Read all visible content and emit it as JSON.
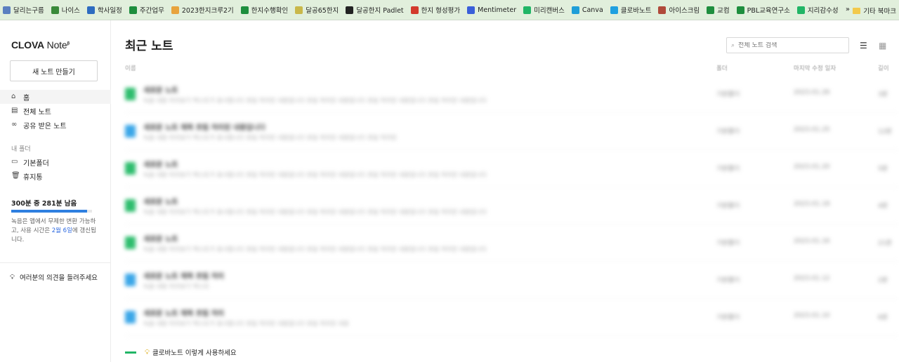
{
  "bookmarks": {
    "items": [
      {
        "label": "달리는구름",
        "color": "#5a7fc0"
      },
      {
        "label": "나이스",
        "color": "#3a8a3a"
      },
      {
        "label": "학사일정",
        "color": "#2d6cc0"
      },
      {
        "label": "주간업무",
        "color": "#1e8e3e"
      },
      {
        "label": "2023한지크루2기",
        "color": "#e8a33d"
      },
      {
        "label": "한지수행확인",
        "color": "#1e8e3e"
      },
      {
        "label": "달공65한지",
        "color": "#c9b84a"
      },
      {
        "label": "달공한지 Padlet",
        "color": "#222222"
      },
      {
        "label": "한지 형성평가",
        "color": "#d33a2c"
      },
      {
        "label": "Mentimeter",
        "color": "#3a5fd9"
      },
      {
        "label": "미리캔버스",
        "color": "#21b566"
      },
      {
        "label": "Canva",
        "color": "#1f9ed8"
      },
      {
        "label": "클로바노트",
        "color": "#1fa0e0"
      },
      {
        "label": "아이스크림",
        "color": "#b04a3a"
      },
      {
        "label": "교컴",
        "color": "#1e8e3e"
      },
      {
        "label": "PBL교육연구소",
        "color": "#1e8e3e"
      },
      {
        "label": "지리감수성",
        "color": "#21b566"
      }
    ],
    "more": "»",
    "other_label": "기타 북마크"
  },
  "sidebar": {
    "logo_main": "CLOVA",
    "logo_note": " Note",
    "logo_mark": "β",
    "new_note": "새 노트 만들기",
    "nav": [
      {
        "label": "홈",
        "icon": "home-icon"
      },
      {
        "label": "전체 노트",
        "icon": "document-icon"
      },
      {
        "label": "공유 받은 노트",
        "icon": "link-icon"
      }
    ],
    "folders_title": "내 폴더",
    "folders": [
      {
        "label": "기본폴더",
        "icon": "folder-icon"
      },
      {
        "label": "휴지통",
        "icon": "trash-icon"
      }
    ],
    "usage": {
      "title": "300분 중 281분 남음",
      "remaining_fraction": 0.937,
      "desc_1": "녹음은 앱에서 무제한 변환 가능하고, 사용 시간은 ",
      "desc_hl": "2월 6일",
      "desc_2": "에 갱신됩니다."
    },
    "feedback": "여러분의 의견을 들려주세요"
  },
  "main": {
    "title": "최근 노트",
    "search_placeholder": "전체 노트 검색",
    "columns": {
      "name": "이름",
      "folder": "폴더",
      "modified": "마지막 수정 일자",
      "length": "길이"
    },
    "rows": [
      {
        "badge_color": "#2ebd6e",
        "title": "새로운 노트",
        "desc": "녹음 내용 미리보기 텍스트가 표시됩니다 흐림 처리된 내용입니다 흐림 처리된 내용입니다 흐림 처리된 내용입니다 흐림 처리된 내용입니다",
        "folder": "기본폴더",
        "date": "2023.01.26",
        "len": "3분"
      },
      {
        "badge_color": "#3aa6e8",
        "title": "새로운 노트 제목 흐림 처리된 내용입니다",
        "desc": "녹음 내용 미리보기 텍스트가 표시됩니다 흐림 처리된 내용입니다 흐림 처리된 내용입니다 흐림 처리된",
        "folder": "기본폴더",
        "date": "2023.01.25",
        "len": "12분"
      },
      {
        "badge_color": "#2ebd6e",
        "title": "새로운 노트",
        "desc": "녹음 내용 미리보기 텍스트가 표시됩니다 흐림 처리된 내용입니다 흐림 처리된 내용입니다 흐림 처리된 내용입니다 흐림 처리된 내용입니다",
        "folder": "기본폴더",
        "date": "2023.01.20",
        "len": "5분"
      },
      {
        "badge_color": "#2ebd6e",
        "title": "새로운 노트",
        "desc": "녹음 내용 미리보기 텍스트가 표시됩니다 흐림 처리된 내용입니다 흐림 처리된 내용입니다 흐림 처리된 내용입니다 흐림 처리된 내용입니다",
        "folder": "기본폴더",
        "date": "2023.01.18",
        "len": "4분"
      },
      {
        "badge_color": "#2ebd6e",
        "title": "새로운 노트",
        "desc": "녹음 내용 미리보기 텍스트가 표시됩니다 흐림 처리된 내용입니다 흐림 처리된 내용입니다 흐림 처리된 내용입니다 흐림 처리된 내용입니다",
        "folder": "기본폴더",
        "date": "2023.01.16",
        "len": "21분"
      },
      {
        "badge_color": "#3aa6e8",
        "title": "새로운 노트 제목 흐림 처리",
        "desc": "녹음 내용 미리보기 텍스트",
        "folder": "기본폴더",
        "date": "2023.01.12",
        "len": "2분"
      },
      {
        "badge_color": "#3aa6e8",
        "title": "새로운 노트 제목 흐림 처리",
        "desc": "녹음 내용 미리보기 텍스트가 표시됩니다 흐림 처리된 내용입니다 흐림 처리된 내용",
        "folder": "기본폴더",
        "date": "2023.01.10",
        "len": "6분"
      }
    ],
    "footer": "클로바노트 이렇게 사용하세요"
  }
}
